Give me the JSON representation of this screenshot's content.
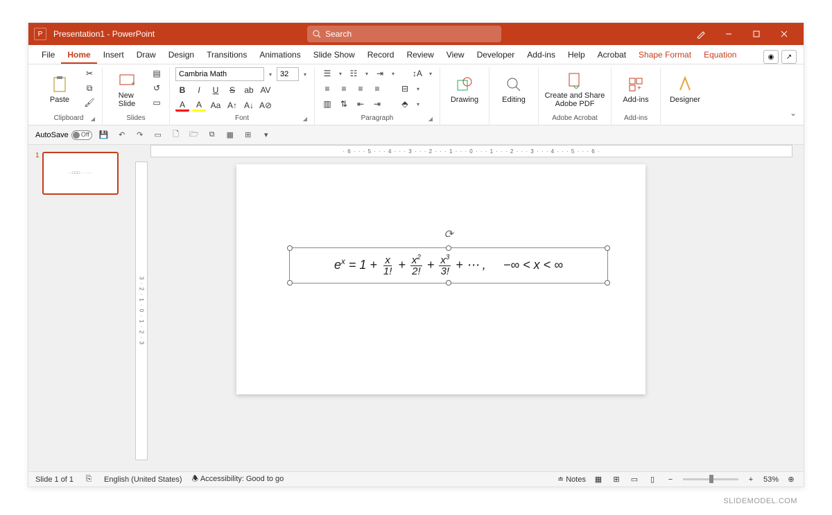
{
  "title": "Presentation1  -  PowerPoint",
  "search_placeholder": "Search",
  "menu": {
    "file": "File",
    "home": "Home",
    "insert": "Insert",
    "draw": "Draw",
    "design": "Design",
    "transitions": "Transitions",
    "animations": "Animations",
    "slideshow": "Slide Show",
    "record": "Record",
    "review": "Review",
    "view": "View",
    "developer": "Developer",
    "addins": "Add-ins",
    "help": "Help",
    "acrobat": "Acrobat",
    "shapeformat": "Shape Format",
    "equation": "Equation"
  },
  "ribbon": {
    "clipboard": {
      "paste": "Paste",
      "label": "Clipboard"
    },
    "slides": {
      "new": "New\nSlide",
      "label": "Slides"
    },
    "font": {
      "name": "Cambria Math",
      "size": "32",
      "label": "Font",
      "bold": "B",
      "italic": "I",
      "underline": "U",
      "strike": "S"
    },
    "paragraph": {
      "label": "Paragraph"
    },
    "drawing": {
      "btn": "Drawing"
    },
    "editing": {
      "btn": "Editing"
    },
    "adobe": {
      "btn": "Create and Share\nAdobe PDF",
      "label": "Adobe Acrobat"
    },
    "addins": {
      "btn": "Add-ins",
      "label": "Add-ins"
    },
    "designer": {
      "btn": "Designer"
    }
  },
  "qat": {
    "autosave": "AutoSave",
    "off": "Off"
  },
  "thumb_num": "1",
  "equation_text": "eˣ = 1 + x/1! + x²/2! + x³/3! + ⋯ ,   −∞ < x < ∞",
  "status": {
    "slide": "Slide 1 of 1",
    "lang": "English (United States)",
    "access": "Accessibility: Good to go",
    "notes": "Notes",
    "zoom": "53%"
  },
  "watermark": "SLIDEMODEL.COM"
}
